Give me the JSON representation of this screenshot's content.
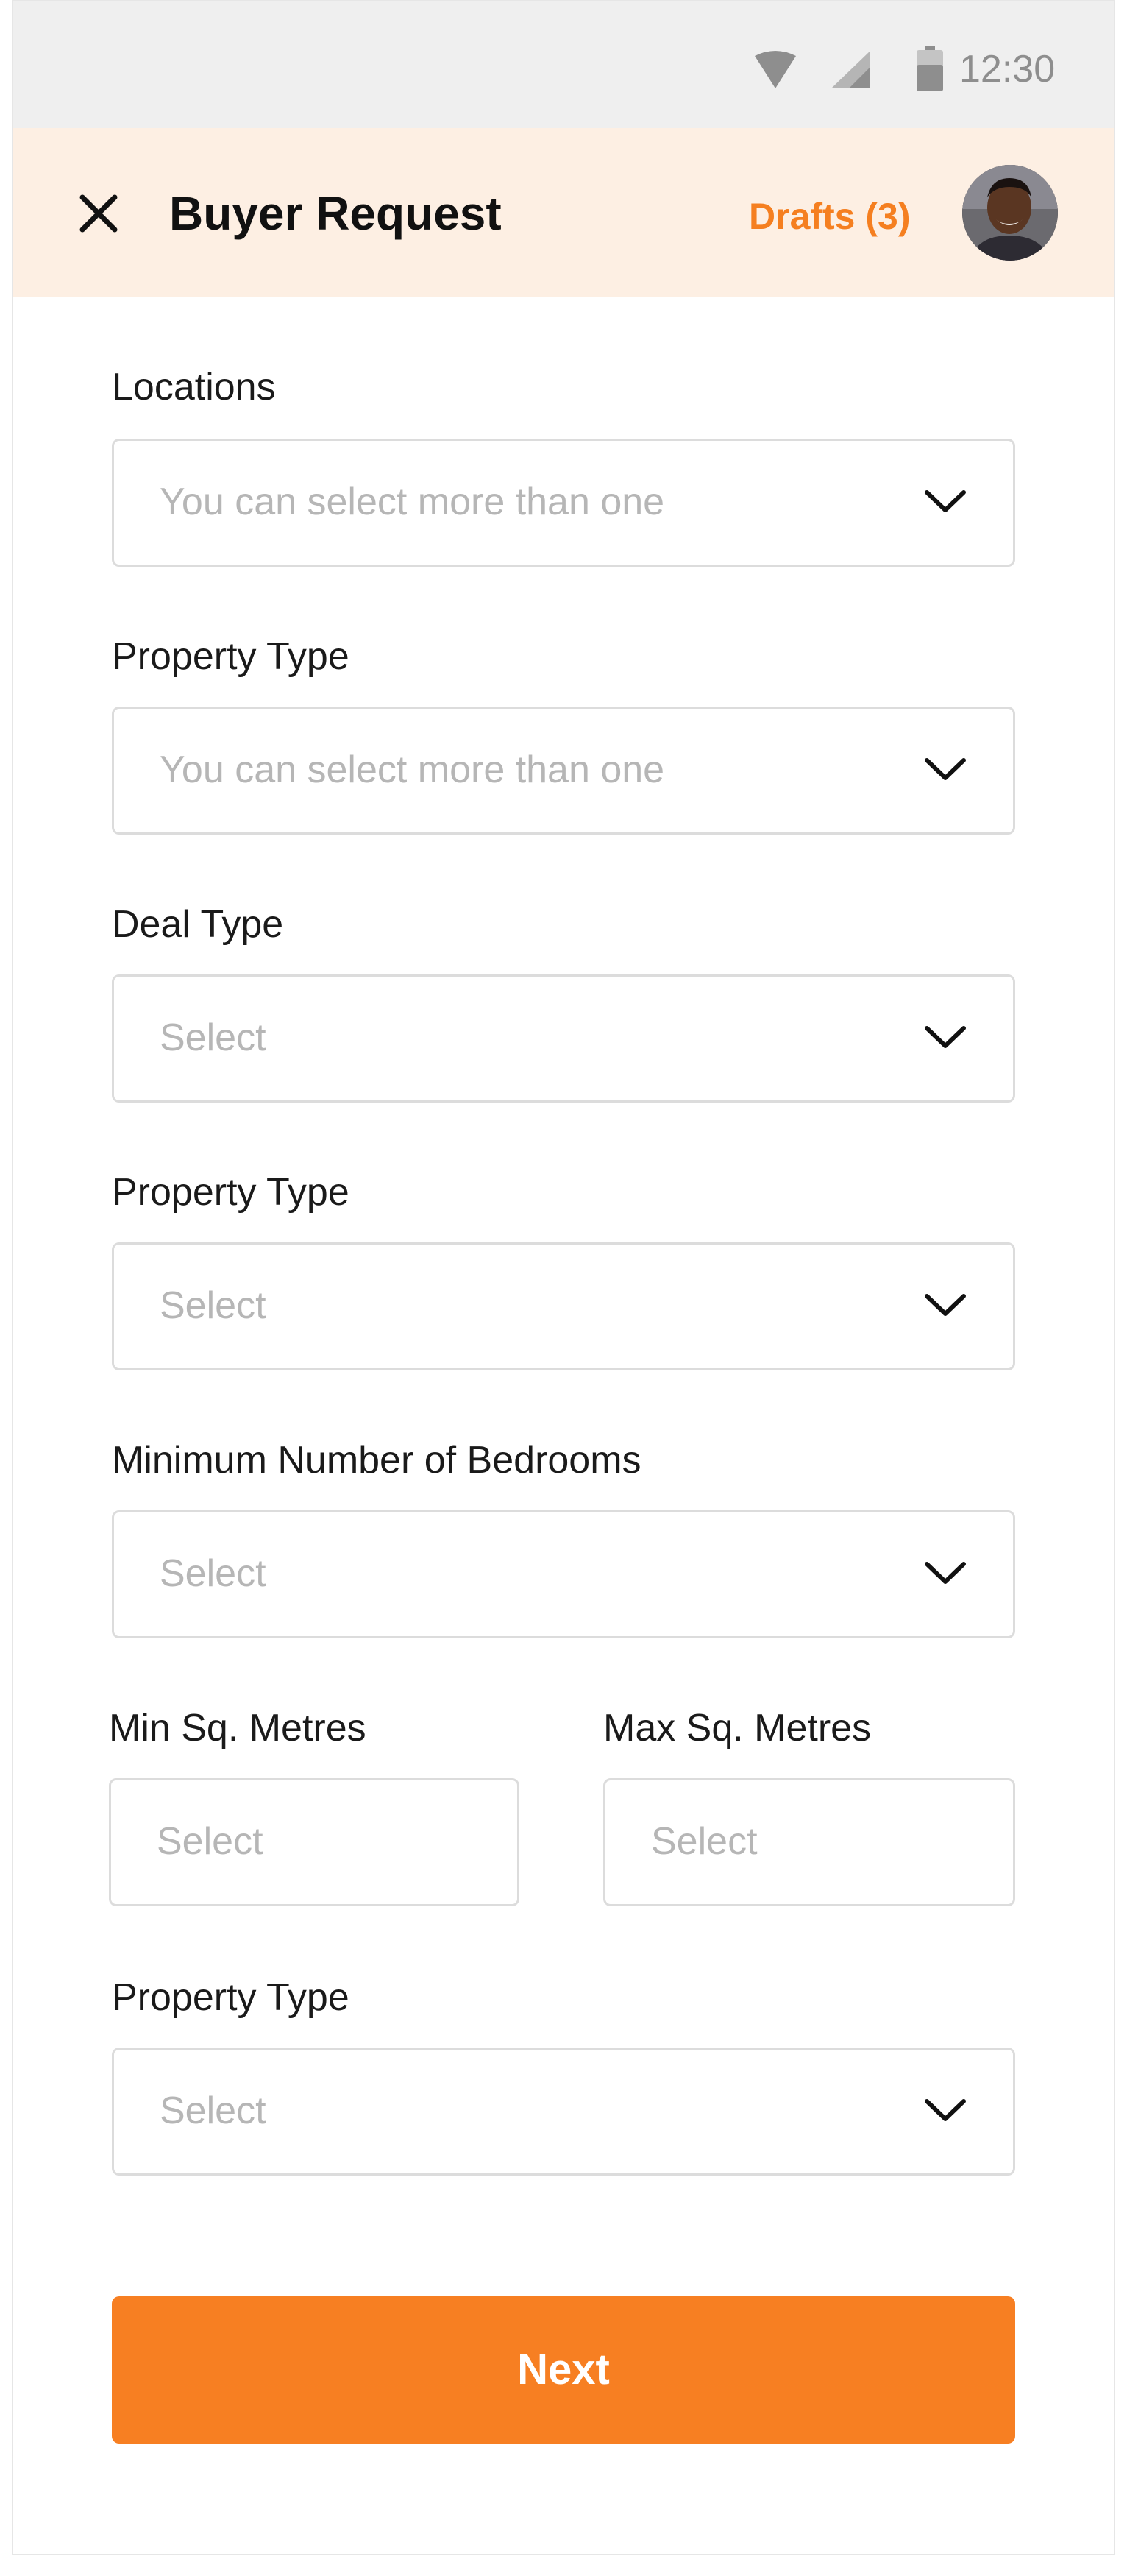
{
  "status_bar": {
    "time": "12:30",
    "icons": [
      "wifi-icon",
      "signal-icon",
      "battery-icon"
    ]
  },
  "header": {
    "title": "Buyer Request",
    "drafts_label": "Drafts (3)",
    "close_icon": "close-icon",
    "accent_color": "#f57f20",
    "background": "#fdefe3"
  },
  "form": {
    "locations": {
      "label": "Locations",
      "placeholder": "You can select more than one"
    },
    "property_type_1": {
      "label": "Property Type",
      "placeholder": "You can select more than one"
    },
    "deal_type": {
      "label": "Deal Type",
      "placeholder": "Select"
    },
    "property_type_2": {
      "label": "Property Type",
      "placeholder": "Select"
    },
    "min_bedrooms": {
      "label": "Minimum Number of Bedrooms",
      "placeholder": "Select"
    },
    "min_sqm": {
      "label": "Min Sq. Metres",
      "placeholder": "Select"
    },
    "max_sqm": {
      "label": "Max Sq. Metres",
      "placeholder": "Select"
    },
    "property_type_3": {
      "label": "Property Type",
      "placeholder": "Select"
    },
    "chevron_icon": "chevron-down-icon"
  },
  "actions": {
    "next_label": "Next",
    "button_color": "#f77f22"
  }
}
